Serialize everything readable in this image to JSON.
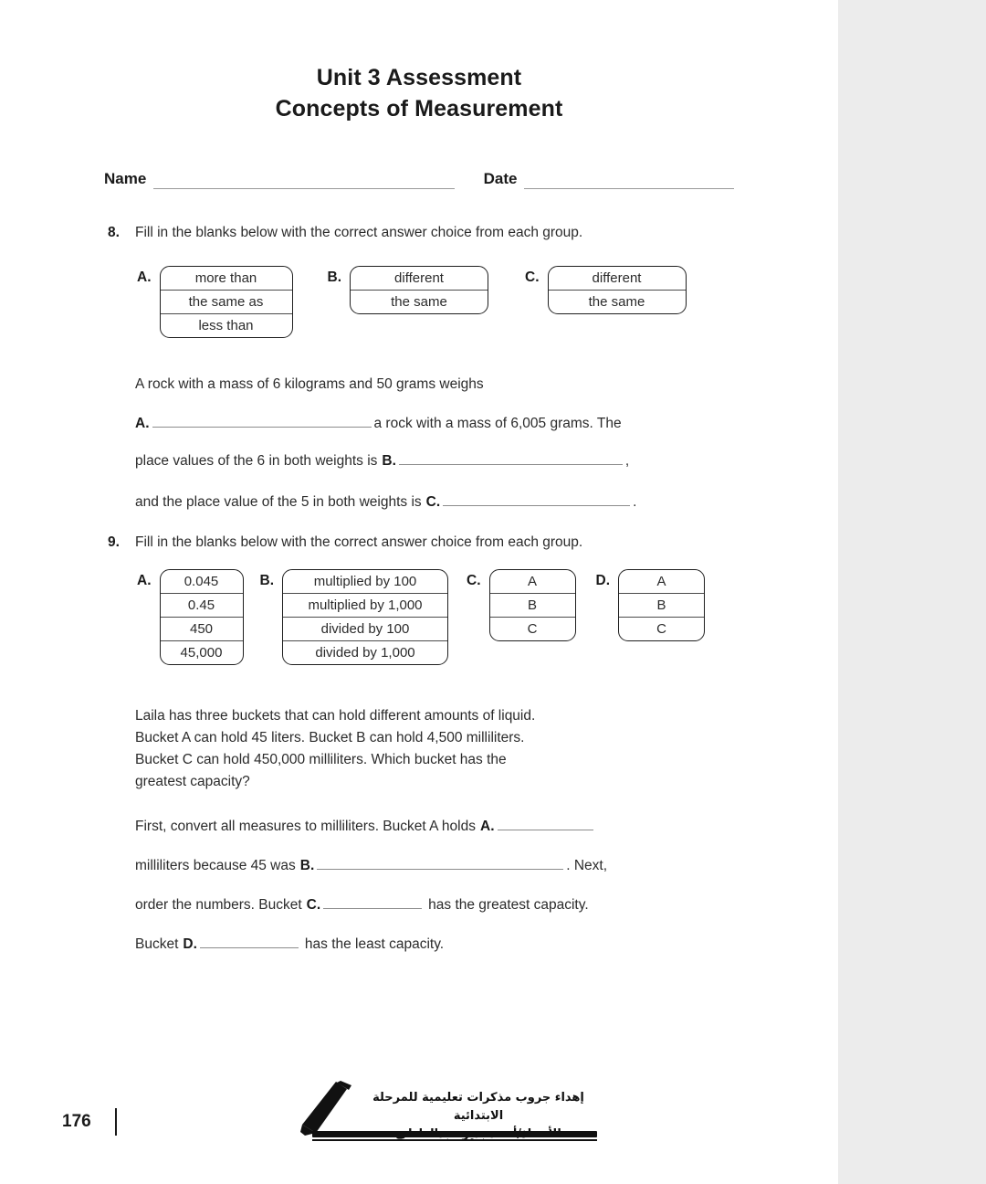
{
  "header": {
    "title_line1": "Unit 3 Assessment",
    "title_line2": "Concepts of Measurement",
    "name_label": "Name",
    "date_label": "Date"
  },
  "questions": [
    {
      "number": "8.",
      "prompt": "Fill in the blanks below with the correct answer choice from each group.",
      "groups": [
        {
          "letter": "A.",
          "options": [
            "more than",
            "the same as",
            "less than"
          ]
        },
        {
          "letter": "B.",
          "options": [
            "different",
            "the same"
          ]
        },
        {
          "letter": "C.",
          "options": [
            "different",
            "the same"
          ]
        }
      ],
      "stem": "A rock with a mass of 6 kilograms and 50 grams weighs",
      "lines": [
        {
          "letter": "A.",
          "before": "",
          "after": "a rock with a mass of 6,005 grams. The"
        },
        {
          "letter": "B.",
          "before": "place values of the 6 in both weights is",
          "after": ","
        },
        {
          "letter": "C.",
          "before": "and the place value of the 5 in both weights is",
          "after": "."
        }
      ]
    },
    {
      "number": "9.",
      "prompt": "Fill in the blanks below with the correct answer choice from each group.",
      "groups": [
        {
          "letter": "A.",
          "options": [
            "0.045",
            "0.45",
            "450",
            "45,000"
          ]
        },
        {
          "letter": "B.",
          "options": [
            "multiplied by 100",
            "multiplied by 1,000",
            "divided by 100",
            "divided by 1,000"
          ]
        },
        {
          "letter": "C.",
          "options": [
            "A",
            "B",
            "C"
          ]
        },
        {
          "letter": "D.",
          "options": [
            "A",
            "B",
            "C"
          ]
        }
      ],
      "stem_lines": [
        "Laila has three buckets that can hold different amounts of liquid.",
        "Bucket A can hold 45 liters. Bucket B can hold 4,500 milliliters.",
        "Bucket C can hold 450,000 milliliters. Which bucket has the",
        "greatest capacity?"
      ],
      "lines": [
        {
          "letter": "A.",
          "before": "First, convert all measures to milliliters. Bucket A holds",
          "after": ""
        },
        {
          "letter": "B.",
          "before": "milliliters because 45 was",
          "after": ". Next,"
        },
        {
          "letter": "C.",
          "before": "order the numbers. Bucket",
          "after": "has the greatest capacity."
        },
        {
          "letter": "D.",
          "before": "Bucket",
          "after": "has the least capacity."
        }
      ]
    }
  ],
  "footer": {
    "page_number": "176",
    "watermark_line1": "إهداء جروب مذكرات تعليمية للمرحلة الابتدائية",
    "watermark_line2": "الأستاذ/أحمد بدير عبدالعاطى",
    "watermark_icon": "pencil-icon"
  },
  "colors": {
    "page_background": "#ffffff",
    "outer_background": "#ececec",
    "text": "#2b2b2b",
    "heading": "#1a1a1a",
    "box_border": "#1f1f1f",
    "rule": "#8c8c8c"
  }
}
